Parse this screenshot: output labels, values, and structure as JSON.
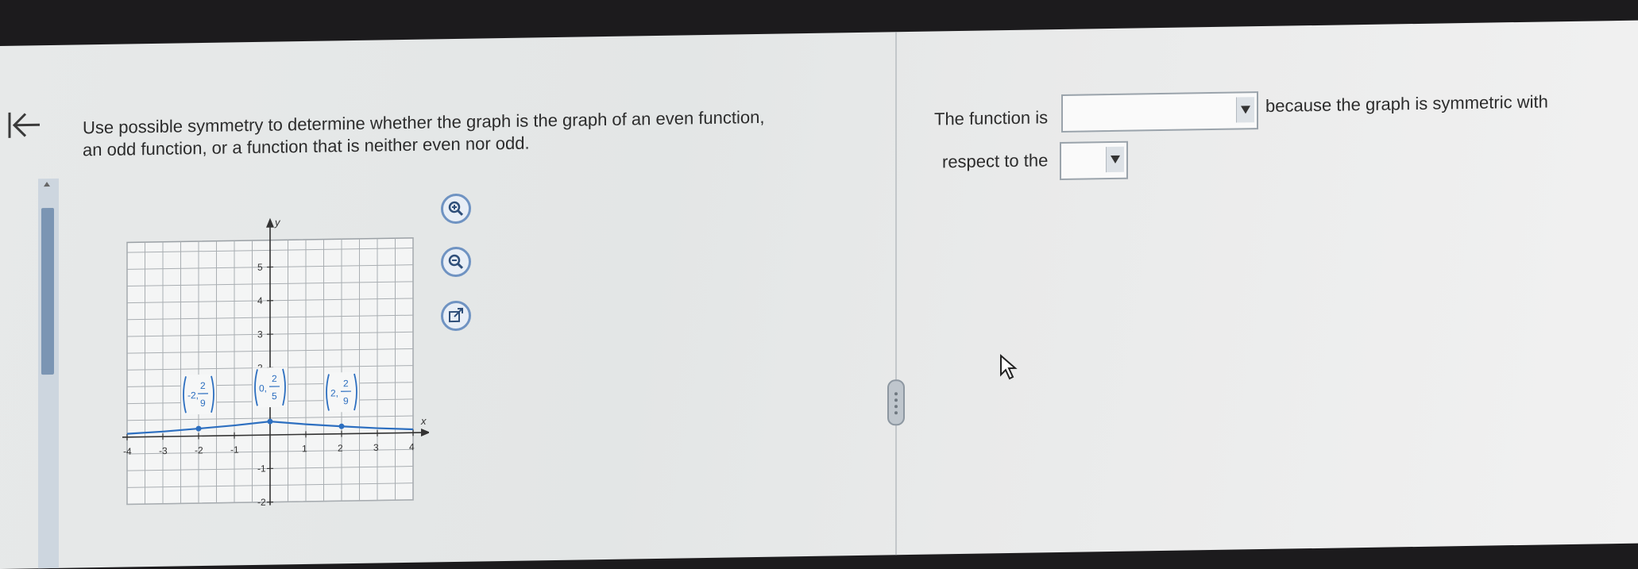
{
  "question": {
    "line1": "Use possible symmetry to determine whether the graph is the graph of an even function,",
    "line2": "an odd function, or a function that is neither even nor odd."
  },
  "icons": {
    "back": "back-arrow-icon",
    "zoom_in": "zoom-in-icon",
    "zoom_out": "zoom-out-icon",
    "popout": "popout-icon",
    "cursor": "mouse-pointer-icon"
  },
  "answer": {
    "label_before_first": "The function is",
    "label_after_first": "because the graph is symmetric with",
    "label_before_second": "respect to the",
    "function_type_selected": "",
    "symmetry_selected": ""
  },
  "chart_data": {
    "type": "line",
    "xlabel": "x",
    "ylabel": "y",
    "xlim": [
      -4,
      4
    ],
    "ylim": [
      -2,
      5
    ],
    "x_ticks": [
      "-4",
      "-3",
      "-2",
      "-1",
      "1",
      "2",
      "3",
      "4"
    ],
    "y_ticks": [
      "5",
      "4",
      "3",
      "2",
      "1",
      "-1",
      "-2"
    ],
    "grid": true,
    "series": [
      {
        "points": [
          [
            -4,
            0.1
          ],
          [
            -3,
            0.15
          ],
          [
            -2,
            0.222
          ],
          [
            -1,
            0.3
          ],
          [
            0,
            0.4
          ],
          [
            1,
            0.3
          ],
          [
            2,
            0.222
          ],
          [
            3,
            0.15
          ],
          [
            4,
            0.1
          ]
        ],
        "color": "#2d6fc0"
      }
    ],
    "marked_points": [
      {
        "x": -2,
        "y": 0.222,
        "label_x": "-2",
        "label_num": "2",
        "label_den": "9"
      },
      {
        "x": 0,
        "y": 0.4,
        "label_x": "0",
        "label_num": "2",
        "label_den": "5"
      },
      {
        "x": 2,
        "y": 0.222,
        "label_x": "2",
        "label_num": "2",
        "label_den": "9"
      }
    ]
  }
}
